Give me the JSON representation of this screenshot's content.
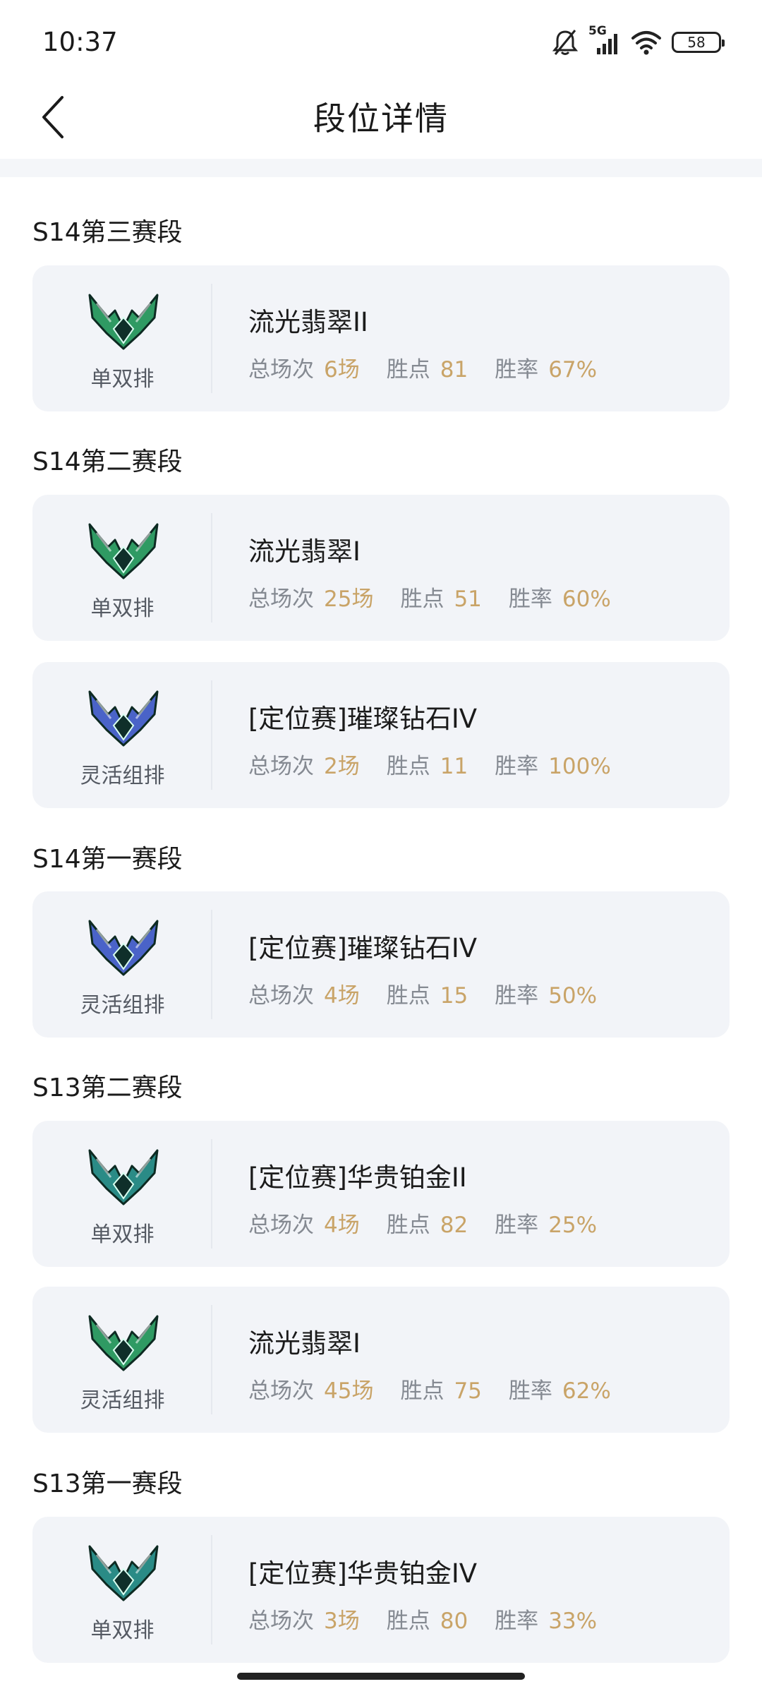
{
  "status_bar": {
    "time": "10:37",
    "network": "5G",
    "battery": "58",
    "icons": [
      "bell-muted-icon",
      "signal-icon",
      "wifi-icon",
      "battery-icon"
    ]
  },
  "header": {
    "title": "段位详情",
    "back_icon": "chevron-left-icon"
  },
  "labels": {
    "total": "总场次",
    "points": "胜点",
    "winrate": "胜率"
  },
  "colors": {
    "accent_value": "#c9a468",
    "card_bg": "#f2f4f8",
    "emerald": "#2f9a63",
    "diamond": "#4a63c8",
    "platinum": "#2a8b86"
  },
  "sections": [
    {
      "title": "S14第三赛段",
      "cards": [
        {
          "queue": "单双排",
          "rank": "流光翡翠II",
          "emblem": "emerald-emblem-icon",
          "games": "6场",
          "points": "81",
          "winrate": "67%"
        }
      ]
    },
    {
      "title": "S14第二赛段",
      "cards": [
        {
          "queue": "单双排",
          "rank": "流光翡翠I",
          "emblem": "emerald-emblem-icon",
          "games": "25场",
          "points": "51",
          "winrate": "60%"
        },
        {
          "queue": "灵活组排",
          "rank": "[定位赛]璀璨钻石IV",
          "emblem": "diamond-emblem-icon",
          "games": "2场",
          "points": "11",
          "winrate": "100%"
        }
      ]
    },
    {
      "title": "S14第一赛段",
      "cards": [
        {
          "queue": "灵活组排",
          "rank": "[定位赛]璀璨钻石IV",
          "emblem": "diamond-emblem-icon",
          "games": "4场",
          "points": "15",
          "winrate": "50%"
        }
      ]
    },
    {
      "title": "S13第二赛段",
      "cards": [
        {
          "queue": "单双排",
          "rank": "[定位赛]华贵铂金II",
          "emblem": "platinum-emblem-icon",
          "games": "4场",
          "points": "82",
          "winrate": "25%"
        },
        {
          "queue": "灵活组排",
          "rank": "流光翡翠I",
          "emblem": "emerald-emblem-icon",
          "games": "45场",
          "points": "75",
          "winrate": "62%"
        }
      ]
    },
    {
      "title": "S13第一赛段",
      "cards": [
        {
          "queue": "单双排",
          "rank": "[定位赛]华贵铂金IV",
          "emblem": "platinum-emblem-icon",
          "games": "3场",
          "points": "80",
          "winrate": "33%"
        }
      ]
    }
  ]
}
